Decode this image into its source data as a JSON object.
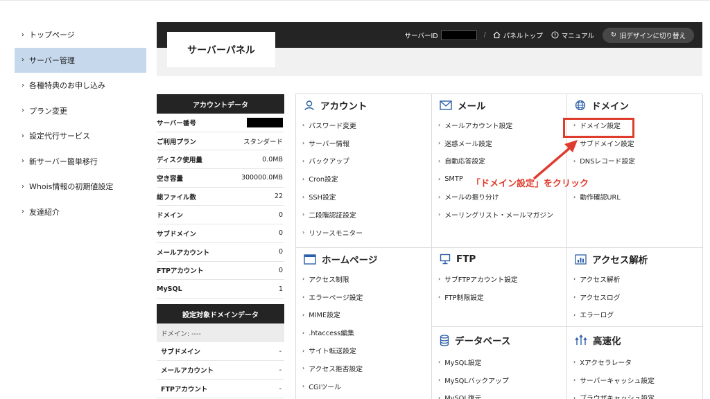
{
  "sidebar": {
    "items": [
      {
        "label": "トップページ"
      },
      {
        "label": "サーバー管理"
      },
      {
        "label": "各種特典のお申し込み"
      },
      {
        "label": "プラン変更"
      },
      {
        "label": "設定代行サービス"
      },
      {
        "label": "新サーバー簡単移行"
      },
      {
        "label": "Whois情報の初期値設定"
      },
      {
        "label": "友達紹介"
      }
    ],
    "active_index": 1
  },
  "header": {
    "panel_title": "サーバーパネル",
    "server_id_label": "サーバーID",
    "panel_top": "パネルトップ",
    "manual": "マニュアル",
    "old_design": "旧デザインに切り替え"
  },
  "account": {
    "title": "アカウントデータ",
    "rows": [
      {
        "key": "サーバー番号",
        "value": ""
      },
      {
        "key": "ご利用プラン",
        "value": "スタンダード"
      },
      {
        "key": "ディスク使用量",
        "value": "0.0MB"
      },
      {
        "key": "空き容量",
        "value": "300000.0MB"
      },
      {
        "key": "総ファイル数",
        "value": "22"
      },
      {
        "key": "ドメイン",
        "value": "0"
      },
      {
        "key": "サブドメイン",
        "value": "0"
      },
      {
        "key": "メールアカウント",
        "value": "0"
      },
      {
        "key": "FTPアカウント",
        "value": "0"
      },
      {
        "key": "MySQL",
        "value": "1"
      }
    ]
  },
  "domain_data": {
    "title": "設定対象ドメインデータ",
    "domain_line": "ドメイン: ----",
    "rows": [
      {
        "key": "サブドメイン",
        "value": "-"
      },
      {
        "key": "メールアカウント",
        "value": "-"
      },
      {
        "key": "FTPアカウント",
        "value": "-"
      }
    ]
  },
  "sections": {
    "account": {
      "title": "アカウント",
      "links": [
        "パスワード変更",
        "サーバー情報",
        "バックアップ",
        "Cron設定",
        "SSH設定",
        "二段階認証設定",
        "リソースモニター"
      ]
    },
    "mail": {
      "title": "メール",
      "links": [
        "メールアカウント設定",
        "迷惑メール設定",
        "自動応答設定",
        "SMTP",
        "メールの振り分け",
        "メーリングリスト・メールマガジン"
      ]
    },
    "domain": {
      "title": "ドメイン",
      "links": [
        "ドメイン設定",
        "サブドメイン設定",
        "DNSレコード設定",
        "",
        "動作確認URL"
      ]
    },
    "homepage": {
      "title": "ホームページ",
      "links": [
        "アクセス制限",
        "エラーページ設定",
        "MIME設定",
        ".htaccess編集",
        "サイト転送設定",
        "アクセス拒否設定",
        "CGIツール"
      ]
    },
    "ftp": {
      "title": "FTP",
      "links": [
        "サブFTPアカウント設定",
        "FTP制限設定"
      ]
    },
    "access": {
      "title": "アクセス解析",
      "links": [
        "アクセス解析",
        "アクセスログ",
        "エラーログ"
      ]
    },
    "database": {
      "title": "データベース",
      "links": [
        "MySQL設定",
        "MySQLバックアップ",
        "MySQL復元"
      ]
    },
    "speed": {
      "title": "高速化",
      "links": [
        "Xアクセラレータ",
        "サーバーキャッシュ設定",
        "ブラウザキャッシュ設定"
      ]
    }
  },
  "annotation": {
    "text": "「ドメイン設定」をクリック",
    "color": "#e03c2e"
  }
}
